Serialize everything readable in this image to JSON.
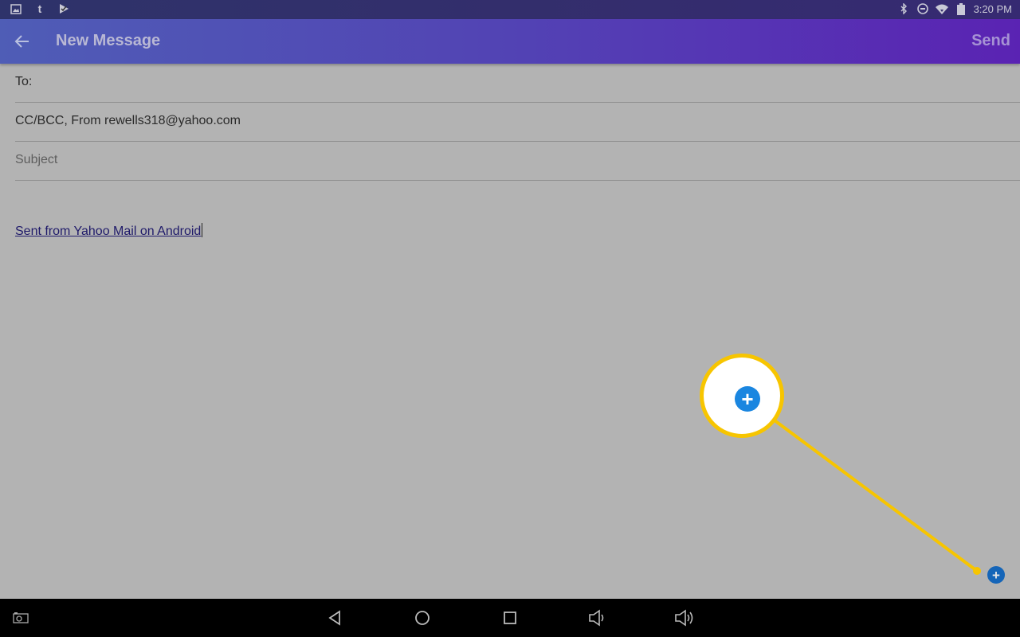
{
  "status_bar": {
    "left_icons": [
      "gallery-icon",
      "tumblr-icon",
      "play-store-icon"
    ],
    "tumblr_glyph": "t",
    "right_icons": [
      "bluetooth-icon",
      "do-not-disturb-icon",
      "wifi-icon",
      "battery-icon"
    ],
    "time": "3:20 PM"
  },
  "app_bar": {
    "back_icon": "arrow-left-icon",
    "title": "New Message",
    "send_label": "Send"
  },
  "compose": {
    "to_label": "To:",
    "cc_from_label": "CC/BCC, From rewells318@yahoo.com",
    "subject_placeholder": "Subject",
    "signature": "Sent from Yahoo Mail on Android"
  },
  "attach_button": {
    "icon": "plus-icon",
    "glyph": "+",
    "highlight_color": "#f7c500",
    "button_color": "#1a86e0"
  },
  "nav_bar": {
    "items": [
      "screenshot-icon",
      "back-icon",
      "home-icon",
      "recents-icon",
      "volume-down-icon",
      "volume-up-icon"
    ]
  }
}
